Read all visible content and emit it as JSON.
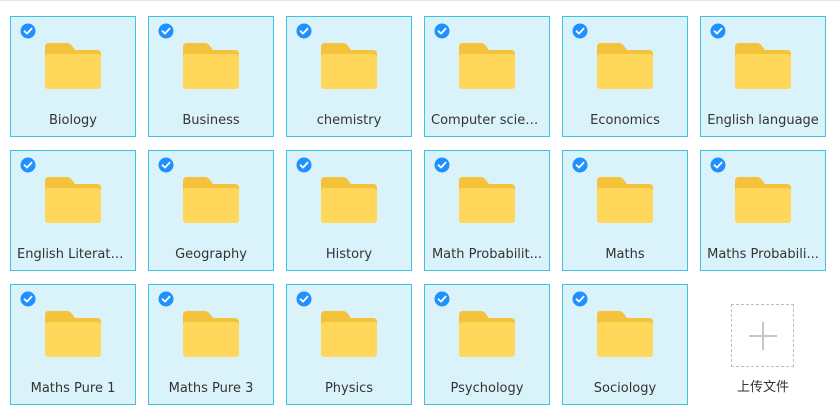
{
  "folders": [
    {
      "name": "Biology",
      "selected": true
    },
    {
      "name": "Business",
      "selected": true
    },
    {
      "name": "chemistry",
      "selected": true
    },
    {
      "name": "Computer scien...",
      "selected": true
    },
    {
      "name": "Economics",
      "selected": true
    },
    {
      "name": "English language",
      "selected": true
    },
    {
      "name": "English Literature",
      "selected": true
    },
    {
      "name": "Geography",
      "selected": true
    },
    {
      "name": "History",
      "selected": true
    },
    {
      "name": "Math Probabilit...",
      "selected": true
    },
    {
      "name": "Maths",
      "selected": true
    },
    {
      "name": "Maths Probabili...",
      "selected": true
    },
    {
      "name": "Maths Pure 1",
      "selected": true
    },
    {
      "name": "Maths Pure 3",
      "selected": true
    },
    {
      "name": "Physics",
      "selected": true
    },
    {
      "name": "Psychology",
      "selected": true
    },
    {
      "name": "Sociology",
      "selected": true
    }
  ],
  "upload": {
    "label": "上传文件",
    "icon": "plus-icon"
  },
  "colors": {
    "tile_bg": "#daf3fb",
    "tile_border": "#3fc3e3",
    "check": "#1e90ff",
    "folder_back": "#f5c33b",
    "folder_front": "#ffd75a"
  }
}
